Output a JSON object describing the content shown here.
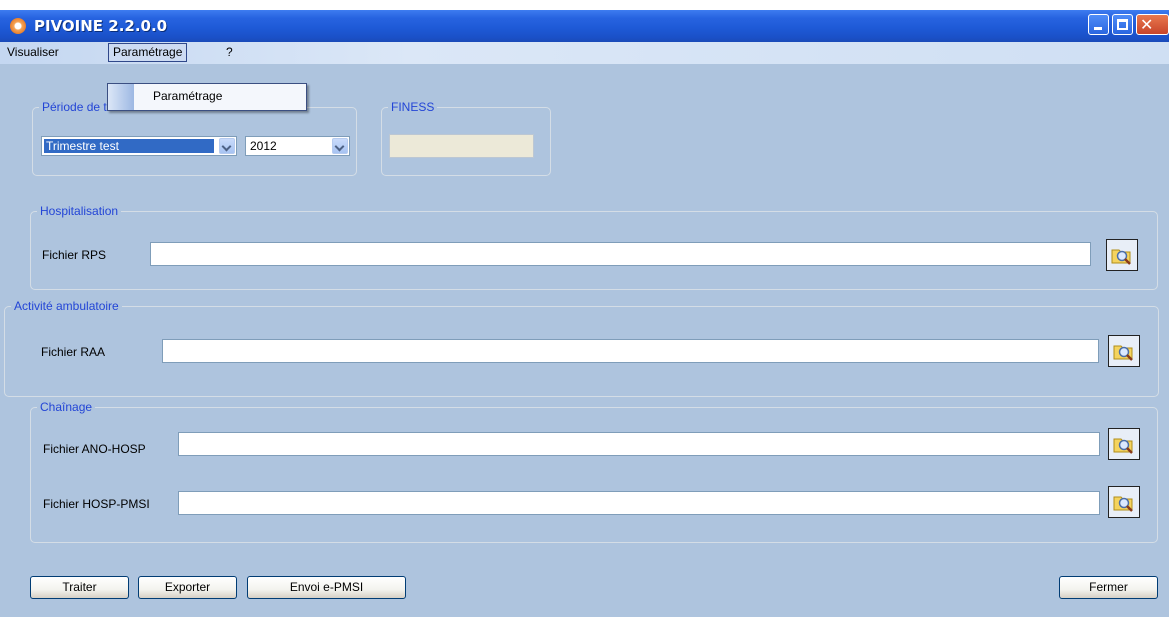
{
  "window": {
    "title": "PIVOINE 2.2.0.0"
  },
  "menubar": {
    "items": [
      {
        "label": "Visualiser"
      },
      {
        "label": "Paramétrage"
      },
      {
        "label": "?"
      }
    ],
    "open_menu": {
      "items": [
        {
          "label": "Paramétrage"
        }
      ]
    }
  },
  "periode": {
    "legend": "Période de traitement",
    "trimestre_value": "Trimestre test",
    "annee_value": "2012"
  },
  "finess": {
    "legend": "FINESS",
    "value": ""
  },
  "hospitalisation": {
    "legend": "Hospitalisation",
    "rps_label": "Fichier RPS",
    "rps_value": ""
  },
  "ambulatoire": {
    "legend": "Activité ambulatoire",
    "raa_label": "Fichier RAA",
    "raa_value": ""
  },
  "chainage": {
    "legend": "Chaînage",
    "ano_label": "Fichier ANO-HOSP",
    "ano_value": "",
    "hosp_label": "Fichier HOSP-PMSI",
    "hosp_value": ""
  },
  "actions": {
    "traiter": "Traiter",
    "exporter": "Exporter",
    "envoi": "Envoi e-PMSI",
    "fermer": "Fermer"
  },
  "icons": {
    "app": "pivoine-app-icon",
    "browse": "browse-folder-icon"
  },
  "colors": {
    "titlebar": "#1e5ad7",
    "legend": "#2345d6",
    "form_bg": "#aec4de",
    "selection": "#316ac5"
  }
}
